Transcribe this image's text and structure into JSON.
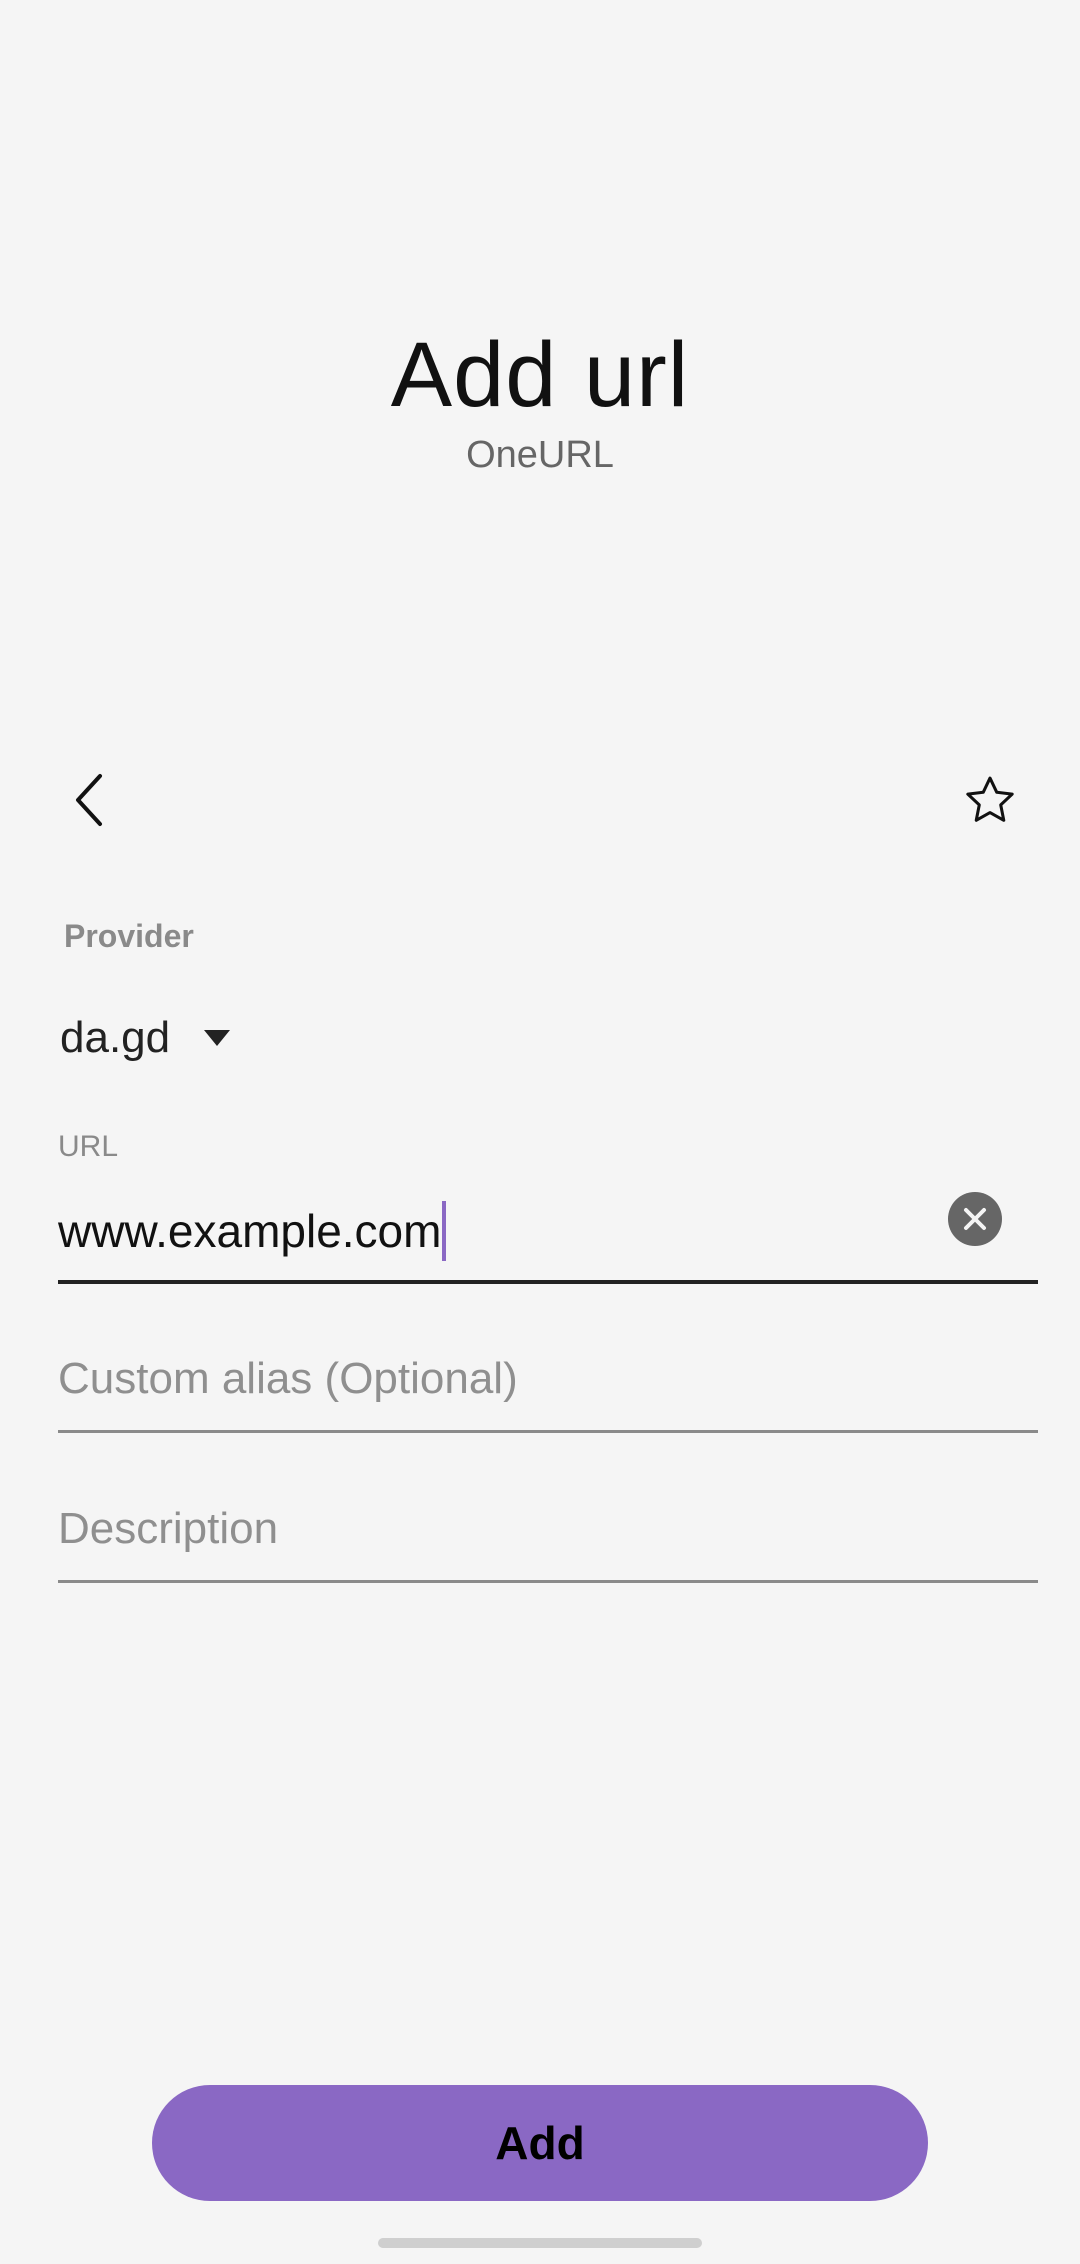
{
  "header": {
    "title": "Add url",
    "subtitle": "OneURL"
  },
  "toolbar": {
    "back_icon": "chevron-left-icon",
    "favorite_icon": "star-icon"
  },
  "form": {
    "provider_label": "Provider",
    "provider_value": "da.gd",
    "url_label": "URL",
    "url_value": "www.example.com",
    "alias_placeholder": "Custom alias (Optional)",
    "description_placeholder": "Description"
  },
  "actions": {
    "add_label": "Add"
  },
  "colors": {
    "accent": "#8a68c4",
    "background": "#f5f5f5"
  }
}
